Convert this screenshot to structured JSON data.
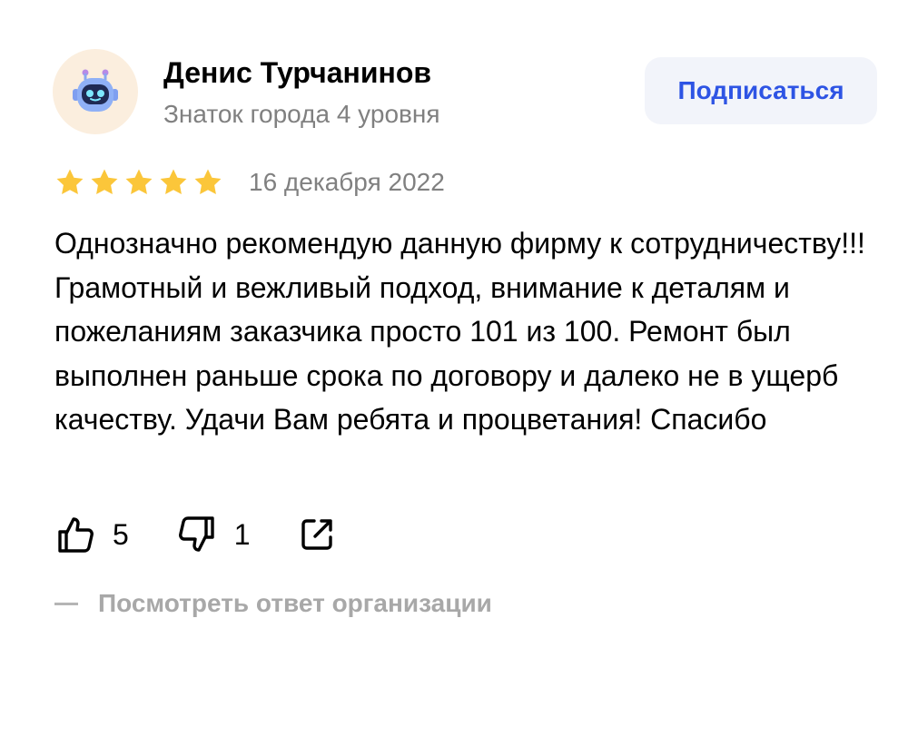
{
  "author": {
    "name": "Денис Турчанинов",
    "level": "Знаток города 4 уровня",
    "avatar_icon": "robot-avatar-icon"
  },
  "subscribe": {
    "label": "Подписаться"
  },
  "rating": {
    "stars": 5,
    "max": 5,
    "star_color": "#fbc63a"
  },
  "review": {
    "date": "16 декабря 2022",
    "text": "Однозначно рекомендую данную фирму к сотрудничеству!!! Грамотный и вежливый подход, внимание к деталям и пожеланиям заказчика просто 101 из 100. Ремонт был выполнен раньше срока по договору и далеко не в ущерб качеству. Удачи Вам ребята и процветания! Спасибо"
  },
  "reactions": {
    "likes": "5",
    "dislikes": "1",
    "like_icon": "thumbs-up-icon",
    "dislike_icon": "thumbs-down-icon",
    "share_icon": "share-icon"
  },
  "org_response": {
    "label": "Посмотреть ответ организации"
  },
  "colors": {
    "accent": "#2e54e4",
    "muted_text": "#808080",
    "button_bg": "#f2f4fa",
    "avatar_bg": "#fbeede"
  }
}
